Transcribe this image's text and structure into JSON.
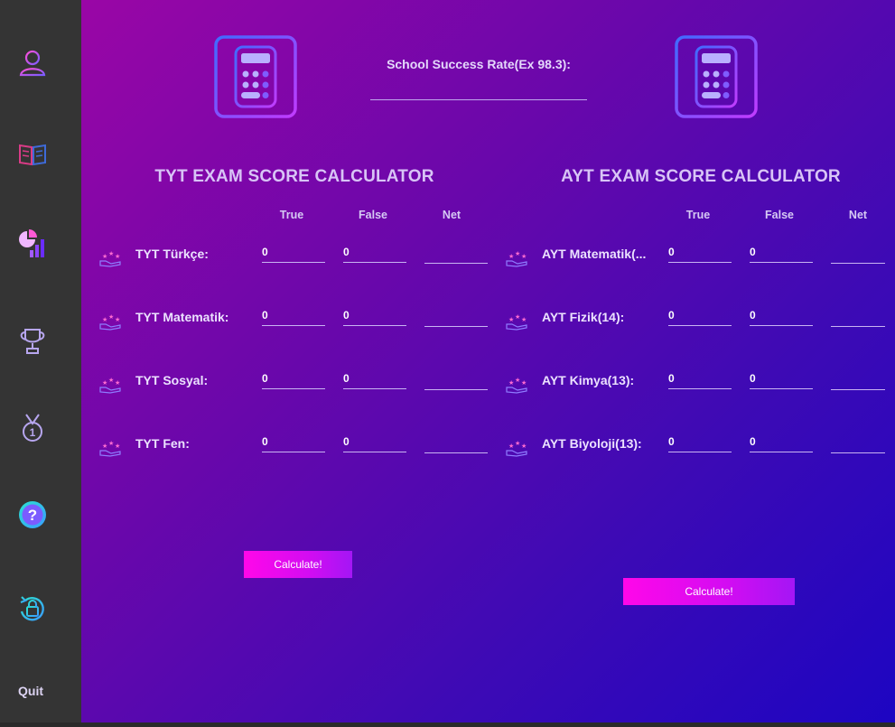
{
  "sidebar": {
    "items": [
      {
        "icon": "user-icon"
      },
      {
        "icon": "book-icon"
      },
      {
        "icon": "stats-chart-icon"
      },
      {
        "icon": "trophy-icon"
      },
      {
        "icon": "medal-icon"
      },
      {
        "icon": "help-icon"
      },
      {
        "icon": "lock-reset-icon"
      }
    ],
    "quit_label": "Quit"
  },
  "header": {
    "success_label": "School Success Rate(Ex 98.3):",
    "success_value": "",
    "left_icon": "calculator-icon",
    "right_icon": "calculator-icon"
  },
  "tyt": {
    "title": "TYT EXAM SCORE CALCULATOR",
    "columns": [
      "True",
      "False",
      "Net"
    ],
    "rows": [
      {
        "label": "TYT Türkçe:",
        "true": "0",
        "false": "0",
        "net": ""
      },
      {
        "label": "TYT Matematik:",
        "true": "0",
        "false": "0",
        "net": ""
      },
      {
        "label": "TYT Sosyal:",
        "true": "0",
        "false": "0",
        "net": ""
      },
      {
        "label": "TYT Fen:",
        "true": "0",
        "false": "0",
        "net": ""
      }
    ],
    "button": "Calculate!"
  },
  "ayt": {
    "title": "AYT EXAM SCORE CALCULATOR",
    "columns": [
      "True",
      "False",
      "Net"
    ],
    "rows": [
      {
        "label": "AYT Matematik(...",
        "true": "0",
        "false": "0",
        "net": ""
      },
      {
        "label": "AYT Fizik(14):",
        "true": "0",
        "false": "0",
        "net": ""
      },
      {
        "label": "AYT Kimya(13):",
        "true": "0",
        "false": "0",
        "net": ""
      },
      {
        "label": "AYT Biyoloji(13):",
        "true": "0",
        "false": "0",
        "net": ""
      }
    ],
    "button": "Calculate!"
  },
  "colors": {
    "sidebar": "#343434",
    "gradient_start": "#9a06a6",
    "gradient_end": "#1d05c2",
    "button": "#ff07e9"
  }
}
